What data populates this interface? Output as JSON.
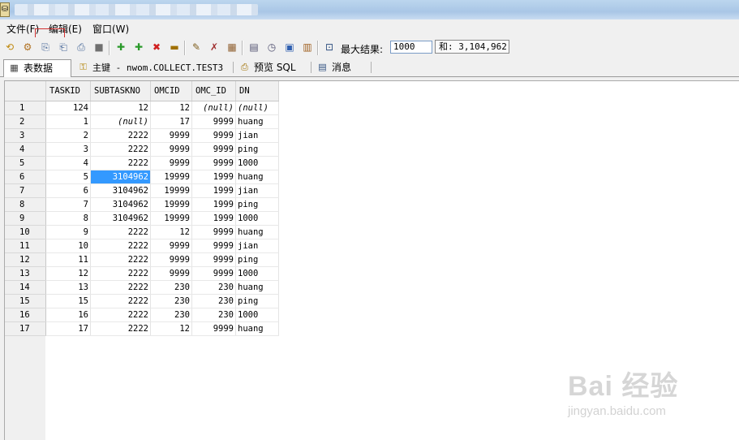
{
  "window": {
    "title_icon": "sql-app-icon"
  },
  "menu": {
    "items": [
      "文件(F)",
      "编辑(E)",
      "窗口(W)"
    ]
  },
  "toolbar": {
    "max_results_label": "最大结果:",
    "max_results_value": "1000",
    "result_count_label": "和:",
    "result_count_value": "3,104,962"
  },
  "tabs": [
    {
      "label": "表数据",
      "icon": "table-icon",
      "active": true
    },
    {
      "label": "主键 - nwom.COLLECT.TEST3",
      "icon": "key-icon",
      "active": false
    },
    {
      "label": "预览 SQL",
      "icon": "preview-icon",
      "active": false
    },
    {
      "label": "消息",
      "icon": "message-icon",
      "active": false
    }
  ],
  "grid": {
    "columns": [
      "TASKID",
      "SUBTASKNO",
      "OMCID",
      "OMC_ID",
      "DN"
    ],
    "rows": [
      [
        "1",
        "124",
        "12",
        "12",
        "(null)",
        "(null)"
      ],
      [
        "2",
        "1",
        "(null)",
        "17",
        "9999",
        "huang"
      ],
      [
        "3",
        "2",
        "2222",
        "9999",
        "9999",
        "jian"
      ],
      [
        "4",
        "3",
        "2222",
        "9999",
        "9999",
        "ping"
      ],
      [
        "5",
        "4",
        "2222",
        "9999",
        "9999",
        "1000"
      ],
      [
        "6",
        "5",
        "3104962",
        "19999",
        "1999",
        "huang"
      ],
      [
        "7",
        "6",
        "3104962",
        "19999",
        "1999",
        "jian"
      ],
      [
        "8",
        "7",
        "3104962",
        "19999",
        "1999",
        "ping"
      ],
      [
        "9",
        "8",
        "3104962",
        "19999",
        "1999",
        "1000"
      ],
      [
        "10",
        "9",
        "2222",
        "12",
        "9999",
        "huang"
      ],
      [
        "11",
        "10",
        "2222",
        "9999",
        "9999",
        "jian"
      ],
      [
        "12",
        "11",
        "2222",
        "9999",
        "9999",
        "ping"
      ],
      [
        "13",
        "12",
        "2222",
        "9999",
        "9999",
        "1000"
      ],
      [
        "14",
        "13",
        "2222",
        "230",
        "230",
        "huang"
      ],
      [
        "15",
        "15",
        "2222",
        "230",
        "230",
        "ping"
      ],
      [
        "16",
        "16",
        "2222",
        "230",
        "230",
        "1000"
      ],
      [
        "17",
        "17",
        "2222",
        "12",
        "9999",
        "huang"
      ]
    ],
    "selected_row": 5,
    "selected_col": 2
  },
  "watermark": {
    "main": "Bai 经验",
    "sub": "jingyan.baidu.com"
  },
  "colors": {
    "selection": "#3399ff",
    "highlight_box": "#d03030"
  }
}
